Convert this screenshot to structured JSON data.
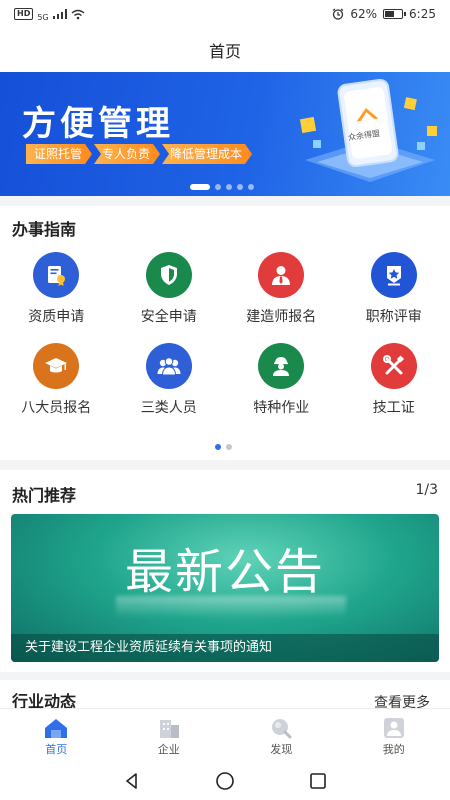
{
  "status_bar": {
    "network_badge": "HD",
    "network_type": "5G",
    "alarm_icon": "alarm-icon",
    "battery_percent": "62%",
    "battery_level": 0.62,
    "time": "6:25"
  },
  "header": {
    "title": "首页"
  },
  "banner": {
    "title": "方便管理",
    "tags": [
      "证照托管",
      "专人负责",
      "降低管理成本"
    ],
    "logo_text": "众余得盟",
    "page_count": 5,
    "active_page": 1
  },
  "services": {
    "title": "办事指南",
    "items": [
      {
        "label": "资质申请",
        "icon": "certificate-icon",
        "color": "#2f5fd7"
      },
      {
        "label": "安全申请",
        "icon": "shield-icon",
        "color": "#1a8a4c"
      },
      {
        "label": "建造师报名",
        "icon": "person-tie-icon",
        "color": "#e23b3b"
      },
      {
        "label": "职称评审",
        "icon": "star-badge-icon",
        "color": "#2155d6"
      },
      {
        "label": "八大员报名",
        "icon": "graduation-cap-icon",
        "color": "#d9741c"
      },
      {
        "label": "三类人员",
        "icon": "group-icon",
        "color": "#2f5fd7"
      },
      {
        "label": "特种作业",
        "icon": "worker-icon",
        "color": "#1a8a4c"
      },
      {
        "label": "技工证",
        "icon": "tools-icon",
        "color": "#e23b3b"
      }
    ],
    "page_count": 2,
    "active_page": 1
  },
  "hot": {
    "title": "热门推荐",
    "pager": "1/3",
    "card_title": "最新公告",
    "card_caption": "关于建设工程企业资质延续有关事项的通知"
  },
  "news": {
    "title": "行业动态",
    "more": "查看更多"
  },
  "tabbar": {
    "items": [
      {
        "label": "首页",
        "icon": "home-icon",
        "active": true
      },
      {
        "label": "企业",
        "icon": "building-icon",
        "active": false
      },
      {
        "label": "发现",
        "icon": "discover-icon",
        "active": false
      },
      {
        "label": "我的",
        "icon": "profile-icon",
        "active": false
      }
    ]
  },
  "colors": {
    "accent": "#2f6fea",
    "banner_blue": "#1f63e6",
    "banner_orange": "#ff9a2e",
    "hot_green": "#1fa58c"
  }
}
